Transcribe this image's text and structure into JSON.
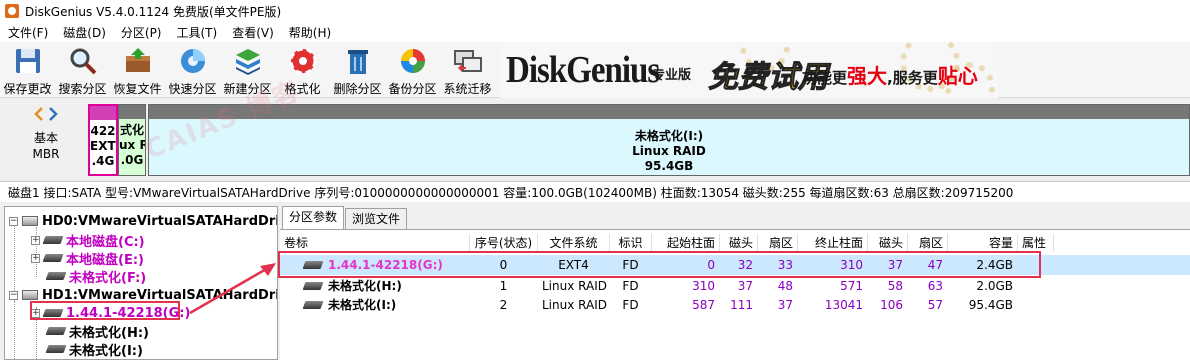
{
  "window": {
    "title": "DiskGenius V5.4.0.1124 免费版(单文件PE版)"
  },
  "menu": [
    "文件(F)",
    "磁盘(D)",
    "分区(P)",
    "工具(T)",
    "查看(V)",
    "帮助(H)"
  ],
  "toolbar": [
    {
      "label": "保存更改",
      "icon": "save-icon"
    },
    {
      "label": "搜索分区",
      "icon": "search-icon"
    },
    {
      "label": "恢复文件",
      "icon": "recover-icon"
    },
    {
      "label": "快速分区",
      "icon": "quick-partition-icon"
    },
    {
      "label": "新建分区",
      "icon": "new-partition-icon"
    },
    {
      "label": "格式化",
      "icon": "format-icon"
    },
    {
      "label": "删除分区",
      "icon": "delete-icon"
    },
    {
      "label": "备份分区",
      "icon": "backup-icon"
    },
    {
      "label": "系统迁移",
      "icon": "migrate-icon"
    }
  ],
  "banner": {
    "logo": "DiskGenius",
    "edition": "专业版",
    "free_trial": "免费试用",
    "slogan_a": "功能更",
    "slogan_b": "强大",
    "slogan_c": ",服务更",
    "slogan_d": "贴心"
  },
  "diskmap": {
    "basic_label_1": "基本",
    "basic_label_2": "MBR",
    "p1_lines": [
      "422",
      "EXT4",
      ".4G"
    ],
    "p2_lines": [
      "式化",
      "ux R",
      ".0G"
    ],
    "p3_lines": [
      "未格式化(I:)",
      "Linux RAID",
      "95.4GB"
    ],
    "watermark": "CAIAS 博客"
  },
  "info": "磁盘1 接口:SATA  型号:VMwareVirtualSATAHardDrive  序列号:0100000000000000001  容量:100.0GB(102400MB)  柱面数:13054  磁头数:255  每道扇区数:63  总扇区数:209715200",
  "tree": {
    "hd0": "HD0:VMwareVirtualSATAHardDriv",
    "hd0_parts": [
      "本地磁盘(C:)",
      "本地磁盘(E:)",
      "未格式化(F:)"
    ],
    "hd1": "HD1:VMwareVirtualSATAHardDriv",
    "hd1_parts": [
      "1.44.1-42218(G:)",
      "未格式化(H:)",
      "未格式化(I:)"
    ]
  },
  "tabs": [
    "分区参数",
    "浏览文件"
  ],
  "table": {
    "headers": [
      "卷标",
      "序号(状态)",
      "文件系统",
      "标识",
      "起始柱面",
      "磁头",
      "扇区",
      "终止柱面",
      "磁头",
      "扇区",
      "容量",
      "属性"
    ],
    "rows": [
      [
        "1.44.1-42218(G:)",
        "0",
        "EXT4",
        "FD",
        "0",
        "32",
        "33",
        "310",
        "37",
        "47",
        "2.4GB",
        ""
      ],
      [
        "未格式化(H:)",
        "1",
        "Linux RAID",
        "FD",
        "310",
        "37",
        "48",
        "571",
        "58",
        "63",
        "2.0GB",
        ""
      ],
      [
        "未格式化(I:)",
        "2",
        "Linux RAID",
        "FD",
        "587",
        "111",
        "37",
        "13041",
        "106",
        "57",
        "95.4GB",
        ""
      ]
    ]
  }
}
